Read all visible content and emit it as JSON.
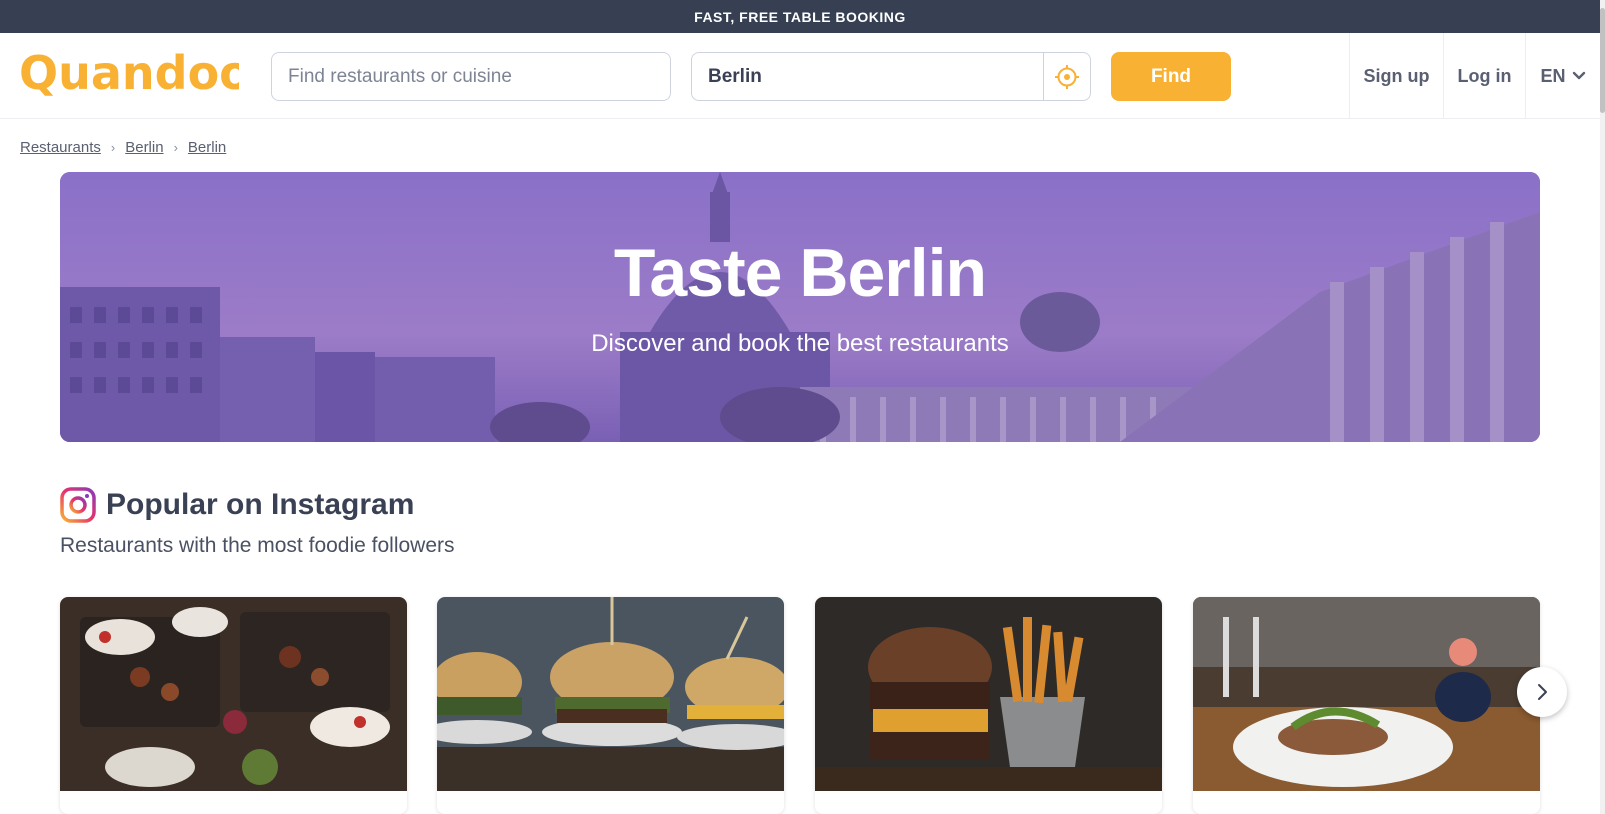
{
  "topbar": {
    "text": "FAST, FREE TABLE BOOKING"
  },
  "header": {
    "logo_text": "Quandoo",
    "search": {
      "placeholder": "Find restaurants or cuisine",
      "value": ""
    },
    "location": {
      "value": "Berlin"
    },
    "find_label": "Find",
    "signup_label": "Sign up",
    "login_label": "Log in",
    "language": "EN"
  },
  "breadcrumb": [
    "Restaurants",
    "Berlin",
    "Berlin"
  ],
  "hero": {
    "title": "Taste Berlin",
    "subtitle": "Discover and book the best restaurants"
  },
  "section": {
    "title": "Popular on Instagram",
    "subtitle": "Restaurants with the most foodie followers"
  },
  "cards": [
    {
      "image": "grill-platter-photo"
    },
    {
      "image": "burgers-photo"
    },
    {
      "image": "burger-fries-photo"
    },
    {
      "image": "restaurant-dish-photo"
    }
  ],
  "colors": {
    "brand": "#f8b133",
    "topbar": "#374052",
    "text": "#3a4154",
    "hero_tint": "#7e66c4"
  },
  "icons": {
    "locate": "crosshair-icon",
    "lang_dropdown": "chevron-down-icon",
    "instagram": "instagram-icon",
    "carousel_next": "chevron-right-icon"
  }
}
